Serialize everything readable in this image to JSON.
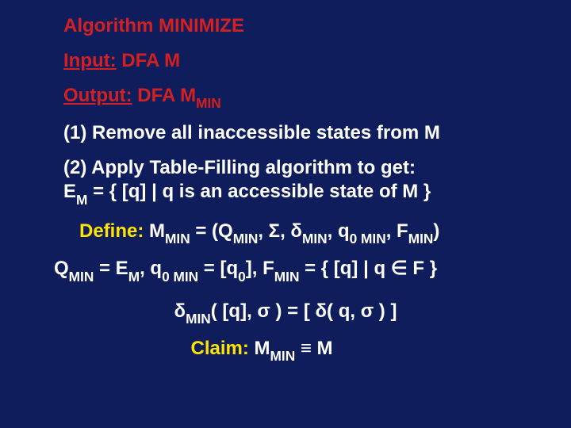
{
  "title": "Algorithm MINIMIZE",
  "input_label": "Input:",
  "input_text": " DFA M",
  "output_label": "Output:",
  "output_text_pre": " DFA M",
  "output_sub": "MIN",
  "step1": "(1) Remove all inaccessible states from M",
  "step2_a": "(2) Apply Table-Filling algorithm to get:",
  "step2_b_pre": "E",
  "step2_b_sub": "M",
  "step2_b_post": " = { [q] | q is an accessible state of M }",
  "define_label": "Define:",
  "define_body_1": " M",
  "define_sub1": "MIN",
  "define_body_2": " = (Q",
  "define_sub2": "MIN",
  "define_body_3": ", Σ, δ",
  "define_sub3": "MIN",
  "define_body_4": ", q",
  "define_sub4": "0 MIN",
  "define_body_5": ", F",
  "define_sub5": "MIN",
  "define_body_6": ")",
  "qline_1": "Q",
  "qline_sub1": "MIN",
  "qline_2": " = E",
  "qline_sub2": "M",
  "qline_3": ",  q",
  "qline_sub3": "0 MIN",
  "qline_4": " = [q",
  "qline_sub4": "0",
  "qline_5": "],  F",
  "qline_sub5": "MIN",
  "qline_6": " = { [q] | q ∈ F }",
  "delta_1": "δ",
  "delta_sub1": "MIN",
  "delta_2": "( [q], σ ) = [ δ( q, σ ) ]",
  "claim_label": "Claim:",
  "claim_1": " M",
  "claim_sub": "MIN",
  "claim_2": " ≡ M"
}
